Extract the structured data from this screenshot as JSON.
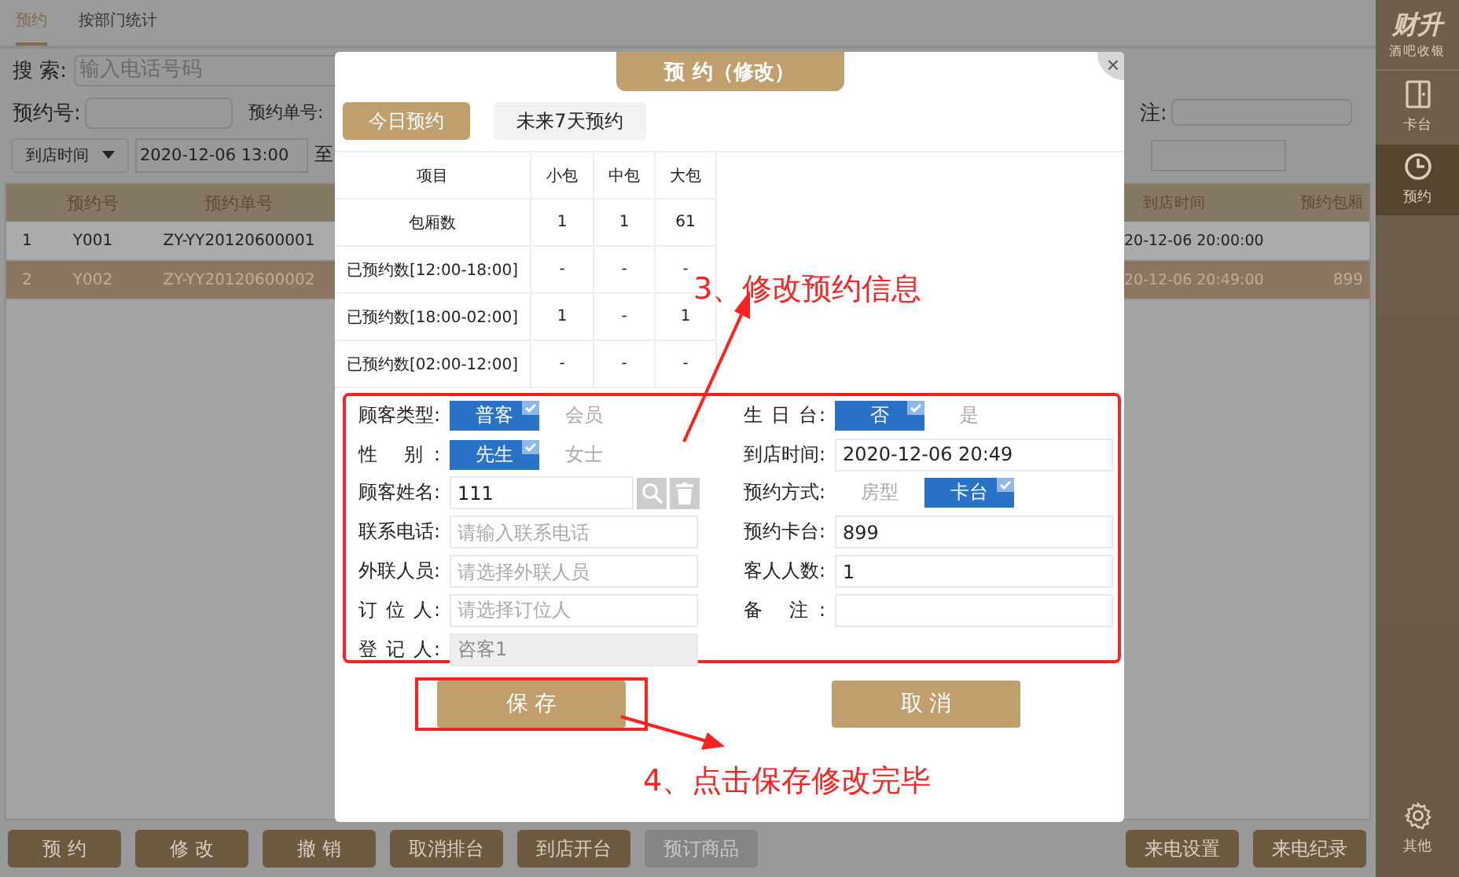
{
  "top_tabs": [
    {
      "label": "预约",
      "selected": true
    },
    {
      "label": "按部门统计",
      "selected": false
    }
  ],
  "filters": {
    "search": {
      "label": "搜 索:",
      "placeholder": "输入电话号码"
    },
    "reservation_no": {
      "label": "预约号:"
    },
    "order_no": {
      "label": "预约单号:"
    },
    "time_type": {
      "value": "到店时间"
    },
    "start_time": {
      "value": "2020-12-06 13:00"
    },
    "range_separator": "至",
    "remark": {
      "label": "注:"
    }
  },
  "table": {
    "columns": [
      "预约号",
      "预约单号",
      "到店时间",
      "预约包厢"
    ],
    "rows": [
      {
        "index": "1",
        "reservation_no": "Y001",
        "order_no": "ZY-YY20120600001",
        "arrival_time": "20-12-06 20:00:00",
        "selected": false
      },
      {
        "index": "2",
        "reservation_no": "Y002",
        "order_no": "ZY-YY20120600002",
        "arrival_time": "20-12-06 20:49:00",
        "room": "899",
        "selected": true
      }
    ]
  },
  "bottom_buttons": [
    {
      "label": "预 约",
      "disabled": false
    },
    {
      "label": "修 改",
      "disabled": false
    },
    {
      "label": "撤 销",
      "disabled": false
    },
    {
      "label": "取消排台",
      "disabled": false
    },
    {
      "label": "到店开台",
      "disabled": false
    },
    {
      "label": "预订商品",
      "disabled": true
    }
  ],
  "bottom_right_buttons": [
    {
      "label": "来电设置",
      "disabled": false
    },
    {
      "label": "来电纪录",
      "disabled": false
    }
  ],
  "sidebar": {
    "logo": {
      "title": "财升",
      "subtitle": "酒吧收银"
    },
    "items": [
      {
        "label": "卡台",
        "selected": false
      },
      {
        "label": "预约",
        "selected": true
      }
    ],
    "footer_item": {
      "label": "其他"
    }
  },
  "dialog": {
    "title": "预 约（修改）",
    "close": "×",
    "tabs": [
      {
        "label": "今日预约",
        "selected": true
      },
      {
        "label": "未来7天预约",
        "selected": false
      }
    ],
    "stats": {
      "columns": [
        "项目",
        "小包",
        "中包",
        "大包"
      ],
      "rows": [
        [
          "包厢数",
          "1",
          "1",
          "61"
        ],
        [
          "已预约数[12:00-18:00]",
          "-",
          "-",
          "-"
        ],
        [
          "已预约数[18:00-02:00]",
          "1",
          "-",
          "1"
        ],
        [
          "已预约数[02:00-12:00]",
          "-",
          "-",
          "-"
        ]
      ]
    },
    "form": {
      "highlighted": true,
      "left": [
        {
          "label": "顾客类型:",
          "kind": "choice",
          "options": [
            {
              "label": "普客",
              "selected": true
            },
            {
              "label": "会员",
              "selected": false
            }
          ]
        },
        {
          "label": "性 别:",
          "kind": "choice",
          "options": [
            {
              "label": "先生",
              "selected": true
            },
            {
              "label": "女士",
              "selected": false
            }
          ]
        },
        {
          "label": "顾客姓名:",
          "kind": "lookup",
          "value": "111",
          "disabled": false
        },
        {
          "label": "联系电话:",
          "kind": "input",
          "placeholder": "请输入联系电话",
          "disabled": false
        },
        {
          "label": "外联人员:",
          "kind": "input",
          "placeholder": "请选择外联人员",
          "disabled": false
        },
        {
          "label": "订 位 人:",
          "kind": "input",
          "placeholder": "请选择订位人",
          "disabled": false
        },
        {
          "label": "登 记 人:",
          "kind": "input",
          "value": "咨客1",
          "disabled": true
        }
      ],
      "right": [
        {
          "label": "生 日 台:",
          "kind": "choice",
          "options": [
            {
              "label": "否",
              "selected": true
            },
            {
              "label": "是",
              "selected": false
            }
          ]
        },
        {
          "label": "到店时间:",
          "kind": "input",
          "value": "2020-12-06 20:49",
          "disabled": false
        },
        {
          "label": "预约方式:",
          "kind": "choice",
          "options": [
            {
              "label": "房型",
              "selected": false
            },
            {
              "label": "卡台",
              "selected": true
            }
          ]
        },
        {
          "label": "预约卡台:",
          "kind": "input",
          "value": "899",
          "disabled": false
        },
        {
          "label": "客人人数:",
          "kind": "input",
          "value": "1",
          "disabled": false
        },
        {
          "label": "备 注:",
          "kind": "input",
          "disabled": false
        }
      ]
    },
    "buttons": [
      {
        "label": "保 存",
        "highlighted": true
      },
      {
        "label": "取 消",
        "highlighted": false
      }
    ],
    "annotations": [
      {
        "text": "3、修改预约信息"
      },
      {
        "text": "4、点击保存修改完毕"
      }
    ]
  }
}
